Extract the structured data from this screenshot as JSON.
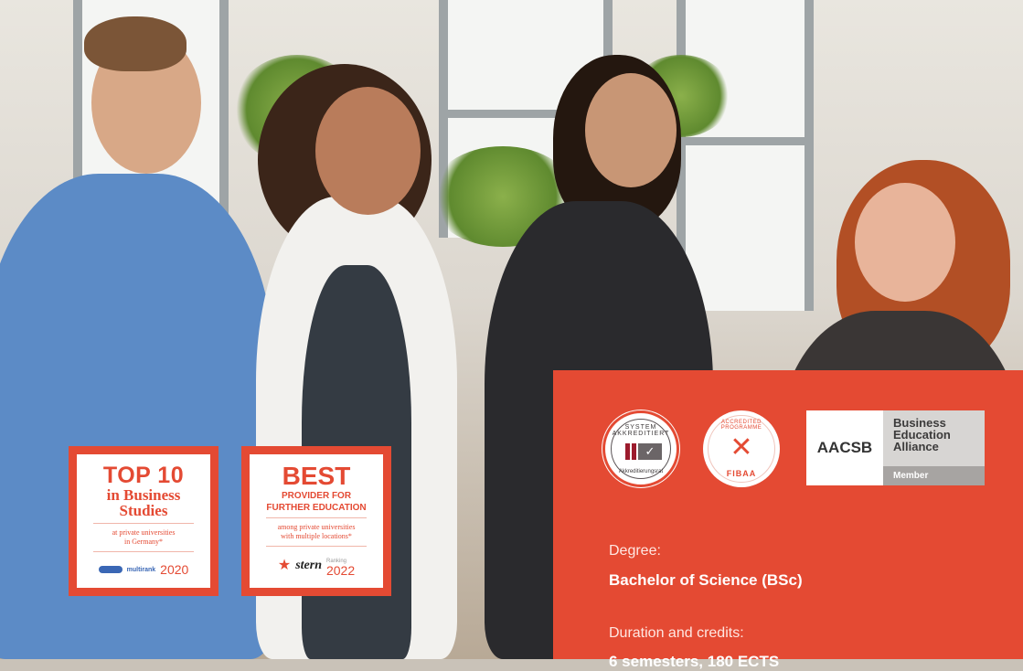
{
  "badges": {
    "top10": {
      "headline": "TOP 10",
      "subline_1": "in Business",
      "subline_2": "Studies",
      "note_1": "at private universities",
      "note_2": "in Germany*",
      "source": "multirank",
      "year": "2020"
    },
    "best": {
      "headline": "BEST",
      "subline_1": "PROVIDER FOR",
      "subline_2": "FURTHER EDUCATION",
      "note_1": "among private universities",
      "note_2": "with multiple locations*",
      "source": "stern",
      "ranking_label": "Ranking",
      "year": "2022"
    }
  },
  "accreditations": {
    "system": {
      "ring_top": "SYSTEM AKKREDITIERT",
      "ring_bottom": "Akkreditierungsrat"
    },
    "fibaa": {
      "ring_top": "ACCREDITED PROGRAMME",
      "name": "FIBAA"
    },
    "aacsb": {
      "abbr": "AACSB",
      "line_1": "Business",
      "line_2": "Education",
      "line_3": "Alliance",
      "status": "Member"
    }
  },
  "program": {
    "degree_label": "Degree:",
    "degree_value": "Bachelor of Science (BSc)",
    "duration_label": "Duration and credits:",
    "duration_value": "6 semesters, 180 ECTS"
  },
  "colors": {
    "brand_red": "#e44a33"
  }
}
